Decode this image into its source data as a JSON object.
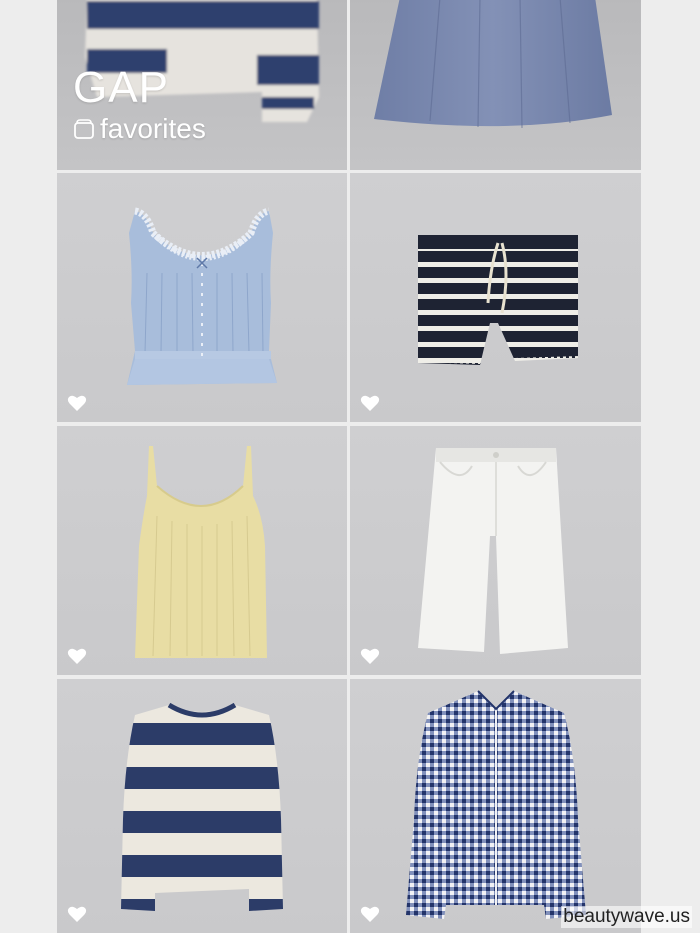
{
  "brand": {
    "name": "GAP",
    "collection_label": "favorites"
  },
  "products": [
    {
      "name": "Striped cropped sweater",
      "icon": "heart-icon"
    },
    {
      "name": "Chambray skirt",
      "icon": "heart-icon"
    },
    {
      "name": "Eyelet lace crop top",
      "icon": "heart-icon"
    },
    {
      "name": "Striped pull-on shorts",
      "icon": "heart-icon"
    },
    {
      "name": "Yellow ribbed tank",
      "icon": "heart-icon"
    },
    {
      "name": "White denim wide-leg capris",
      "icon": "heart-icon"
    },
    {
      "name": "Rugby stripe long-sleeve tee",
      "icon": "heart-icon"
    },
    {
      "name": "Gingham button-down shirt",
      "icon": "heart-icon"
    }
  ],
  "watermark": "beautywave.us",
  "colors": {
    "navy": "#2c3c68",
    "chambray": "#6f7fa6",
    "light_blue": "#9bb3d4",
    "butter_yellow": "#e6dba3",
    "white_denim": "#f2f2f0",
    "tile_bg": "#cbcbcd"
  }
}
